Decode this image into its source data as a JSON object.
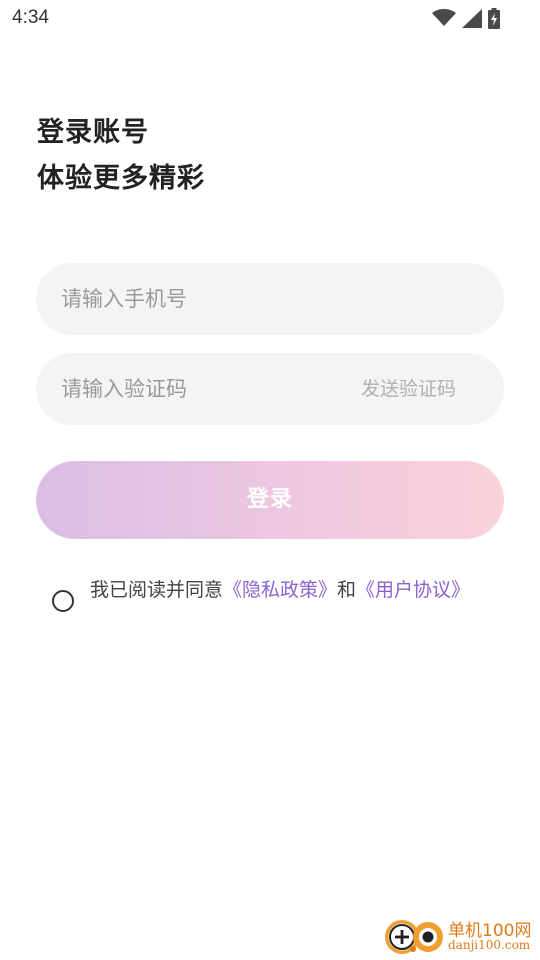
{
  "status_bar": {
    "time": "4:34",
    "icons": [
      "wifi-icon",
      "signal-icon",
      "battery-charging-icon"
    ]
  },
  "header": {
    "title_line1": "登录账号",
    "title_line2": "体验更多精彩"
  },
  "form": {
    "phone": {
      "value": "",
      "placeholder": "请输入手机号"
    },
    "code": {
      "value": "",
      "placeholder": "请输入验证码",
      "send_code_label": "发送验证码"
    },
    "login_label": "登录"
  },
  "agreement": {
    "checked": false,
    "prefix": "我已阅读并同意",
    "privacy_link": "《隐私政策》",
    "conjunction": "和",
    "terms_link": "《用户协议》"
  },
  "watermark": {
    "name": "单机100网",
    "url": "danji100.com"
  },
  "colors": {
    "accent_link": "#8a63cf",
    "login_gradient_start": "#dcbde6",
    "login_gradient_end": "#fbd1da",
    "field_background": "#f4f4f4",
    "watermark": "#e07a18"
  }
}
